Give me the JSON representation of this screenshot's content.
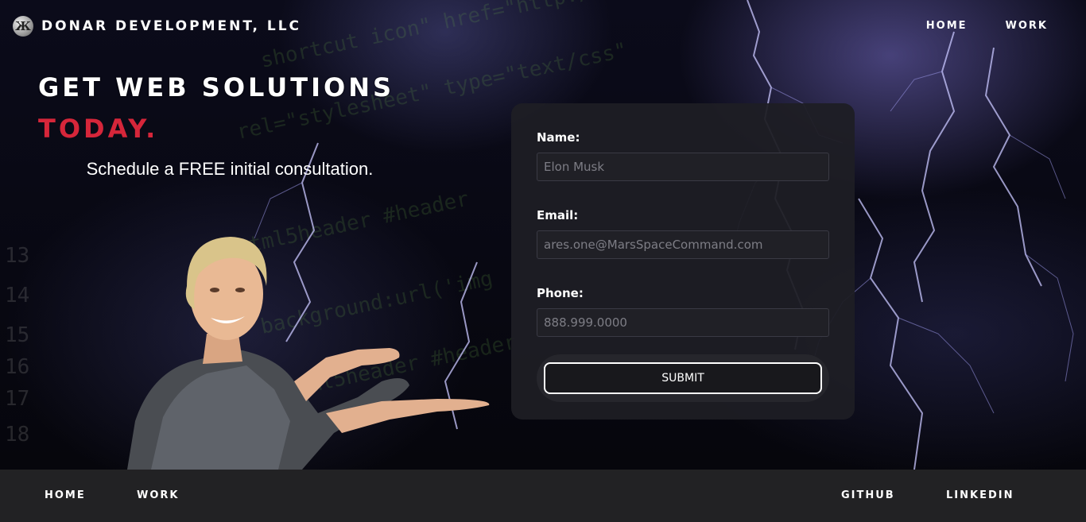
{
  "brand": {
    "name": "DONAR DEVELOPMENT, LLC",
    "logo_icon": "brand-logo-icon"
  },
  "nav": {
    "home": "HOME",
    "work": "WORK"
  },
  "hero": {
    "headline_line1": "GET WEB SOLUTIONS",
    "headline_line2": "TODAY.",
    "subline": "Schedule a FREE initial consultation."
  },
  "form": {
    "name_label": "Name:",
    "name_placeholder": "Elon Musk",
    "email_label": "Email:",
    "email_placeholder": "ares.one@MarsSpaceCommand.com",
    "phone_label": "Phone:",
    "phone_placeholder": "888.999.0000",
    "submit_label": "SUBMIT"
  },
  "footer": {
    "home": "HOME",
    "work": "WORK",
    "github": "GITHUB",
    "linkedin": "LINKEDIN"
  },
  "colors": {
    "accent_red": "#d6263a",
    "footer_bg": "#222224",
    "card_bg": "#1e1e24"
  }
}
